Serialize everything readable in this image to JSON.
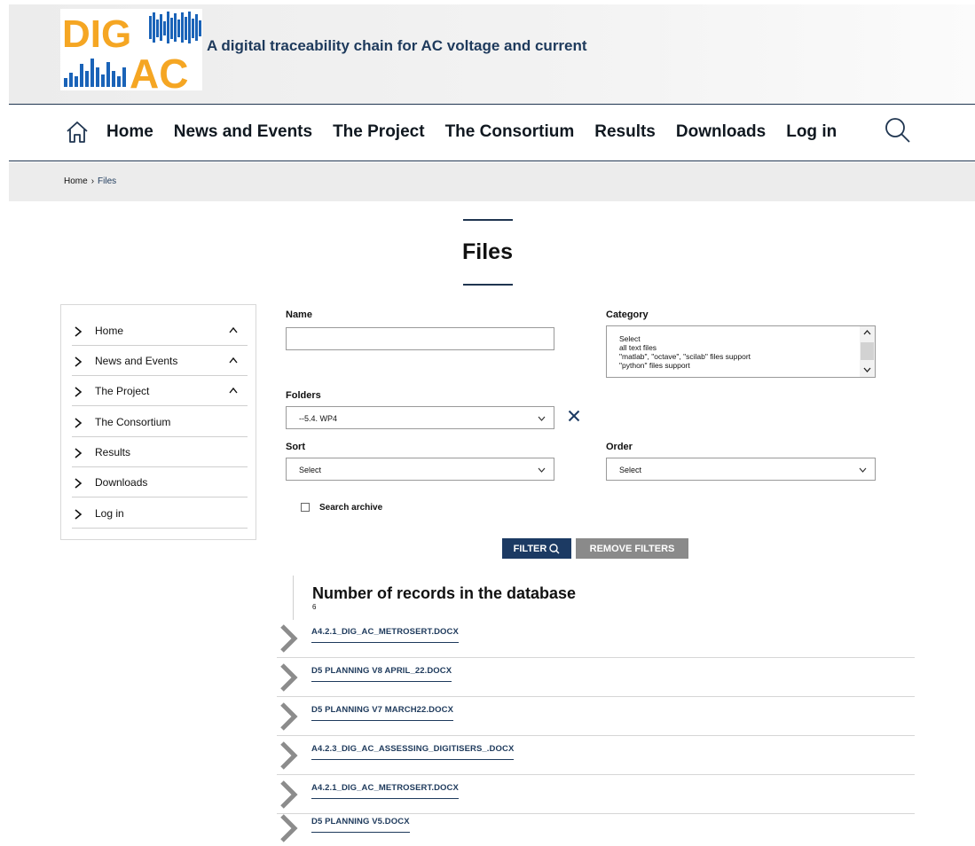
{
  "header": {
    "logo": {
      "text_top": "DIG",
      "text_bottom": "AC",
      "colors": {
        "orange": "#f5a623",
        "blue": "#1a63b8"
      }
    },
    "tagline": "A digital traceability chain for AC voltage and current"
  },
  "nav": {
    "items": [
      {
        "label": "Home"
      },
      {
        "label": "News and Events"
      },
      {
        "label": "The Project"
      },
      {
        "label": "The Consortium"
      },
      {
        "label": "Results"
      },
      {
        "label": "Downloads"
      },
      {
        "label": "Log in"
      }
    ],
    "icons": {
      "home": "home-icon",
      "search": "search-icon"
    }
  },
  "breadcrumb": {
    "home": "Home",
    "separator": "›",
    "current": "Files"
  },
  "page": {
    "title": "Files"
  },
  "sidebar": {
    "items": [
      {
        "label": "Home",
        "expandable": true
      },
      {
        "label": "News and Events",
        "expandable": true
      },
      {
        "label": "The Project",
        "expandable": true
      },
      {
        "label": "The Consortium",
        "expandable": false
      },
      {
        "label": "Results",
        "expandable": false
      },
      {
        "label": "Downloads",
        "expandable": false
      },
      {
        "label": "Log in",
        "expandable": false
      }
    ]
  },
  "filters": {
    "name": {
      "label": "Name",
      "value": "",
      "placeholder": ""
    },
    "category": {
      "label": "Category",
      "options": [
        "Select",
        "all text files",
        "\"matlab\", \"octave\", \"scilab\" files support",
        "\"python\" files support"
      ]
    },
    "folders": {
      "label": "Folders",
      "value": "--5.4. WP4"
    },
    "sort": {
      "label": "Sort",
      "value": "Select"
    },
    "order": {
      "label": "Order",
      "value": "Select"
    },
    "search_archive": {
      "label": "Search archive",
      "checked": false
    },
    "filter_button": "FILTER",
    "remove_button": "REMOVE FILTERS"
  },
  "records": {
    "title": "Number of records in the database",
    "count": "6",
    "files": [
      "A4.2.1_DIG_AC_METROSERT.DOCX",
      "D5 PLANNING V8 APRIL_22.DOCX",
      "D5 PLANNING V7 MARCH22.DOCX",
      "A4.2.3_DIG_AC_ASSESSING_DIGITISERS_.DOCX",
      "A4.2.1_DIG_AC_METROSERT.DOCX",
      "D5 PLANNING V5.DOCX"
    ]
  },
  "colors": {
    "navy": "#1c3a63",
    "link": "#1e3a5c",
    "grey_button": "#8a8a8a",
    "chevron_grey": "#8c8c8c"
  }
}
